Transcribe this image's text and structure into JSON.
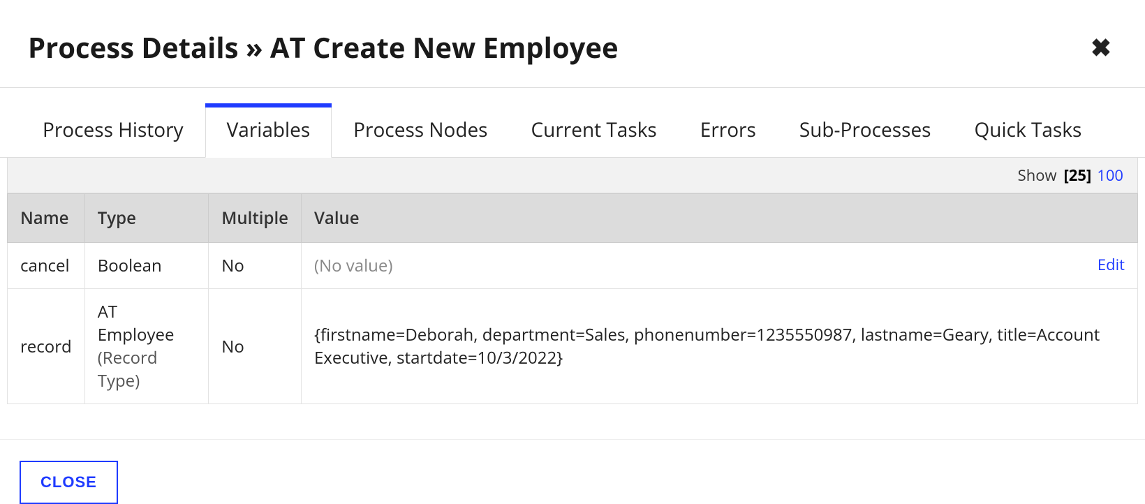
{
  "header": {
    "title": "Process Details » AT Create New Employee"
  },
  "tabs": [
    {
      "label": "Process History",
      "active": false
    },
    {
      "label": "Variables",
      "active": true
    },
    {
      "label": "Process Nodes",
      "active": false
    },
    {
      "label": "Current Tasks",
      "active": false
    },
    {
      "label": "Errors",
      "active": false
    },
    {
      "label": "Sub-Processes",
      "active": false
    },
    {
      "label": "Quick Tasks",
      "active": false
    }
  ],
  "show": {
    "label": "Show",
    "options": [
      "25",
      "100"
    ],
    "selected": "25"
  },
  "table": {
    "columns": [
      "Name",
      "Type",
      "Multiple",
      "Value"
    ],
    "rows": [
      {
        "name": "cancel",
        "type": "Boolean",
        "type_secondary": "",
        "multiple": "No",
        "value": "(No value)",
        "no_value": true,
        "edit_label": "Edit",
        "editable": true
      },
      {
        "name": "record",
        "type": "AT Employee",
        "type_secondary": "(Record Type)",
        "multiple": "No",
        "value": "{firstname=Deborah, department=Sales, phonenumber=1235550987, lastname=Geary, title=Account Executive, startdate=10/3/2022}",
        "no_value": false,
        "edit_label": "",
        "editable": false
      }
    ]
  },
  "buttons": {
    "close": "CLOSE"
  }
}
